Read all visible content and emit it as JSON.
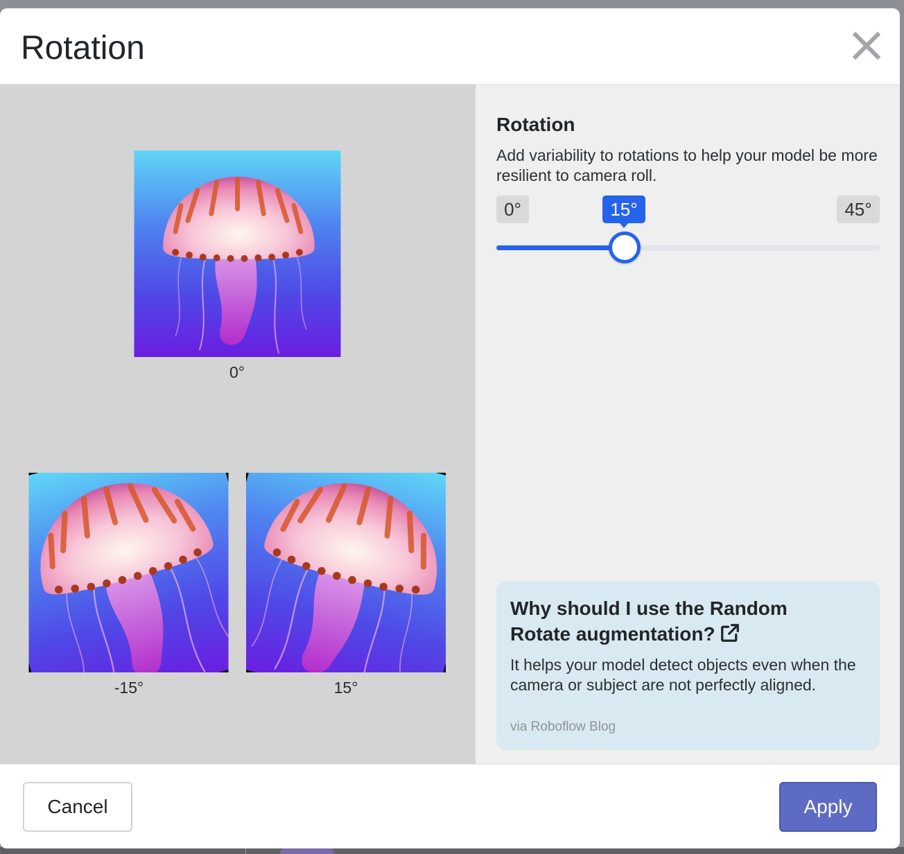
{
  "modal": {
    "title": "Rotation"
  },
  "preview": {
    "original_label": "0°",
    "negative_label": "-15°",
    "positive_label": "15°"
  },
  "settings": {
    "section_title": "Rotation",
    "description": "Add variability to rotations to help your model be more resilient to camera roll.",
    "slider": {
      "min_label": "0°",
      "max_label": "45°",
      "value_label": "15°",
      "min": 0,
      "max": 45,
      "value": 15,
      "accent_color": "#2563eb"
    }
  },
  "info_card": {
    "title": "Why should I use the Random Rotate augmentation?",
    "body": "It helps your model detect objects even when the camera or subject are not perfectly aligned.",
    "source": "via Roboflow Blog"
  },
  "footer": {
    "cancel_label": "Cancel",
    "apply_label": "Apply",
    "apply_color": "#5e6bc4"
  }
}
